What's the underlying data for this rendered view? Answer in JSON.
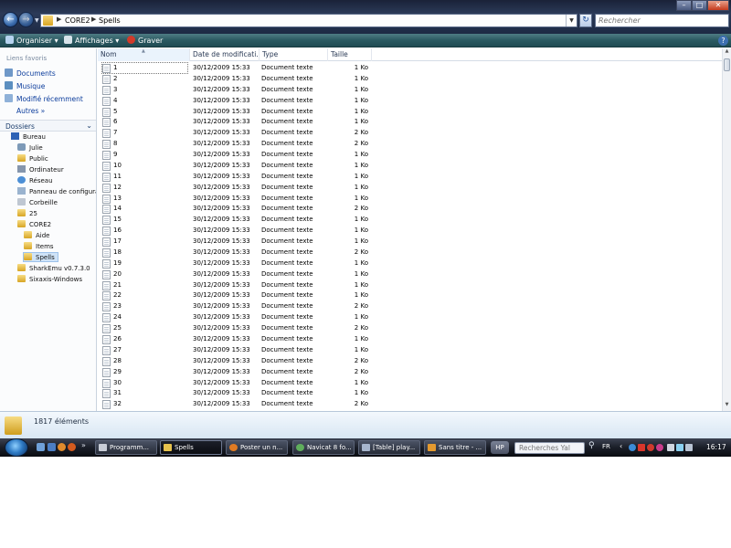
{
  "window": {
    "breadcrumb": [
      "CORE2",
      "Spells"
    ],
    "search_placeholder": "Rechercher"
  },
  "toolbar": {
    "organize_label": "Organiser",
    "views_label": "Affichages",
    "burn_label": "Graver"
  },
  "sidebar": {
    "favorites_header": "Liens favoris",
    "favorites": [
      "Documents",
      "Musique",
      "Modifié récemment"
    ],
    "more_label": "Autres",
    "folders_header": "Dossiers",
    "tree": [
      {
        "label": "Bureau",
        "icon": "desktop-icon",
        "level": 0
      },
      {
        "label": "Julie",
        "icon": "user-folder-icon",
        "level": 1
      },
      {
        "label": "Public",
        "icon": "folder-icon",
        "level": 1
      },
      {
        "label": "Ordinateur",
        "icon": "computer-icon",
        "level": 1
      },
      {
        "label": "Réseau",
        "icon": "network-icon",
        "level": 1
      },
      {
        "label": "Panneau de configura",
        "icon": "control-panel-icon",
        "level": 1
      },
      {
        "label": "Corbeille",
        "icon": "recycle-bin-icon",
        "level": 1
      },
      {
        "label": "25",
        "icon": "folder-icon",
        "level": 1
      },
      {
        "label": "CORE2",
        "icon": "folder-icon",
        "level": 1
      },
      {
        "label": "Aide",
        "icon": "folder-icon",
        "level": 2
      },
      {
        "label": "Items",
        "icon": "folder-icon",
        "level": 2
      },
      {
        "label": "Spells",
        "icon": "folder-icon",
        "level": 2,
        "selected": true
      },
      {
        "label": "SharkEmu v0.7.3.0",
        "icon": "folder-icon",
        "level": 1
      },
      {
        "label": "Sixaxis-Windows",
        "icon": "folder-icon",
        "level": 1
      }
    ]
  },
  "file_list": {
    "columns": [
      "Nom",
      "Date de modificati...",
      "Type",
      "Taille"
    ],
    "rows": [
      {
        "name": "1",
        "date": "30/12/2009 15:33",
        "type": "Document texte",
        "size": "1 Ko"
      },
      {
        "name": "2",
        "date": "30/12/2009 15:33",
        "type": "Document texte",
        "size": "1 Ko"
      },
      {
        "name": "3",
        "date": "30/12/2009 15:33",
        "type": "Document texte",
        "size": "1 Ko"
      },
      {
        "name": "4",
        "date": "30/12/2009 15:33",
        "type": "Document texte",
        "size": "1 Ko"
      },
      {
        "name": "5",
        "date": "30/12/2009 15:33",
        "type": "Document texte",
        "size": "1 Ko"
      },
      {
        "name": "6",
        "date": "30/12/2009 15:33",
        "type": "Document texte",
        "size": "1 Ko"
      },
      {
        "name": "7",
        "date": "30/12/2009 15:33",
        "type": "Document texte",
        "size": "2 Ko"
      },
      {
        "name": "8",
        "date": "30/12/2009 15:33",
        "type": "Document texte",
        "size": "2 Ko"
      },
      {
        "name": "9",
        "date": "30/12/2009 15:33",
        "type": "Document texte",
        "size": "1 Ko"
      },
      {
        "name": "10",
        "date": "30/12/2009 15:33",
        "type": "Document texte",
        "size": "1 Ko"
      },
      {
        "name": "11",
        "date": "30/12/2009 15:33",
        "type": "Document texte",
        "size": "1 Ko"
      },
      {
        "name": "12",
        "date": "30/12/2009 15:33",
        "type": "Document texte",
        "size": "1 Ko"
      },
      {
        "name": "13",
        "date": "30/12/2009 15:33",
        "type": "Document texte",
        "size": "1 Ko"
      },
      {
        "name": "14",
        "date": "30/12/2009 15:33",
        "type": "Document texte",
        "size": "2 Ko"
      },
      {
        "name": "15",
        "date": "30/12/2009 15:33",
        "type": "Document texte",
        "size": "1 Ko"
      },
      {
        "name": "16",
        "date": "30/12/2009 15:33",
        "type": "Document texte",
        "size": "1 Ko"
      },
      {
        "name": "17",
        "date": "30/12/2009 15:33",
        "type": "Document texte",
        "size": "1 Ko"
      },
      {
        "name": "18",
        "date": "30/12/2009 15:33",
        "type": "Document texte",
        "size": "2 Ko"
      },
      {
        "name": "19",
        "date": "30/12/2009 15:33",
        "type": "Document texte",
        "size": "1 Ko"
      },
      {
        "name": "20",
        "date": "30/12/2009 15:33",
        "type": "Document texte",
        "size": "1 Ko"
      },
      {
        "name": "21",
        "date": "30/12/2009 15:33",
        "type": "Document texte",
        "size": "1 Ko"
      },
      {
        "name": "22",
        "date": "30/12/2009 15:33",
        "type": "Document texte",
        "size": "1 Ko"
      },
      {
        "name": "23",
        "date": "30/12/2009 15:33",
        "type": "Document texte",
        "size": "2 Ko"
      },
      {
        "name": "24",
        "date": "30/12/2009 15:33",
        "type": "Document texte",
        "size": "1 Ko"
      },
      {
        "name": "25",
        "date": "30/12/2009 15:33",
        "type": "Document texte",
        "size": "2 Ko"
      },
      {
        "name": "26",
        "date": "30/12/2009 15:33",
        "type": "Document texte",
        "size": "1 Ko"
      },
      {
        "name": "27",
        "date": "30/12/2009 15:33",
        "type": "Document texte",
        "size": "1 Ko"
      },
      {
        "name": "28",
        "date": "30/12/2009 15:33",
        "type": "Document texte",
        "size": "2 Ko"
      },
      {
        "name": "29",
        "date": "30/12/2009 15:33",
        "type": "Document texte",
        "size": "2 Ko"
      },
      {
        "name": "30",
        "date": "30/12/2009 15:33",
        "type": "Document texte",
        "size": "1 Ko"
      },
      {
        "name": "31",
        "date": "30/12/2009 15:33",
        "type": "Document texte",
        "size": "1 Ko"
      },
      {
        "name": "32",
        "date": "30/12/2009 15:33",
        "type": "Document texte",
        "size": "2 Ko"
      }
    ]
  },
  "details": {
    "item_count": "1817 éléments"
  },
  "taskbar": {
    "buttons": [
      "Programm...",
      "Spells",
      "Poster un n...",
      "Navicat 8 fo...",
      "[Table] play...",
      "Sans titre - ..."
    ],
    "hp_label": "HP",
    "search_placeholder": "Recherches Yal",
    "language": "FR",
    "clock": "16:17"
  }
}
